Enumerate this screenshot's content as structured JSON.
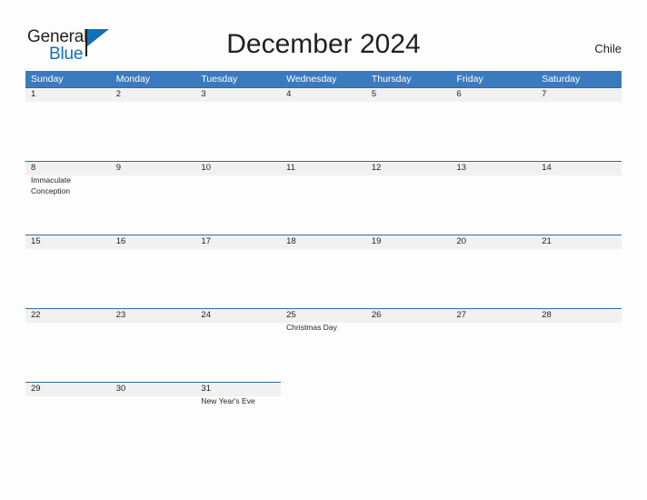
{
  "brand": {
    "name_part1": "General",
    "name_part2": "Blue",
    "flag_icon": "blue-triangle-flag-icon",
    "accent_color": "#1270b8"
  },
  "header": {
    "title": "December 2024",
    "region": "Chile"
  },
  "calendar": {
    "header_bg_color": "#3a7bbf",
    "day_band_color": "#f1f1f1",
    "day_band_border_color": "#2e6da4",
    "weekdays": [
      "Sunday",
      "Monday",
      "Tuesday",
      "Wednesday",
      "Thursday",
      "Friday",
      "Saturday"
    ],
    "weeks": [
      {
        "filled_days": 7,
        "days": [
          {
            "num": "1",
            "events": []
          },
          {
            "num": "2",
            "events": []
          },
          {
            "num": "3",
            "events": []
          },
          {
            "num": "4",
            "events": []
          },
          {
            "num": "5",
            "events": []
          },
          {
            "num": "6",
            "events": []
          },
          {
            "num": "7",
            "events": []
          }
        ]
      },
      {
        "filled_days": 7,
        "days": [
          {
            "num": "8",
            "events": [
              "Immaculate Conception"
            ]
          },
          {
            "num": "9",
            "events": []
          },
          {
            "num": "10",
            "events": []
          },
          {
            "num": "11",
            "events": []
          },
          {
            "num": "12",
            "events": []
          },
          {
            "num": "13",
            "events": []
          },
          {
            "num": "14",
            "events": []
          }
        ]
      },
      {
        "filled_days": 7,
        "days": [
          {
            "num": "15",
            "events": []
          },
          {
            "num": "16",
            "events": []
          },
          {
            "num": "17",
            "events": []
          },
          {
            "num": "18",
            "events": []
          },
          {
            "num": "19",
            "events": []
          },
          {
            "num": "20",
            "events": []
          },
          {
            "num": "21",
            "events": []
          }
        ]
      },
      {
        "filled_days": 7,
        "days": [
          {
            "num": "22",
            "events": []
          },
          {
            "num": "23",
            "events": []
          },
          {
            "num": "24",
            "events": []
          },
          {
            "num": "25",
            "events": [
              "Christmas Day"
            ]
          },
          {
            "num": "26",
            "events": []
          },
          {
            "num": "27",
            "events": []
          },
          {
            "num": "28",
            "events": []
          }
        ]
      },
      {
        "filled_days": 3,
        "days": [
          {
            "num": "29",
            "events": []
          },
          {
            "num": "30",
            "events": []
          },
          {
            "num": "31",
            "events": [
              "New Year's Eve"
            ]
          },
          {
            "num": "",
            "events": []
          },
          {
            "num": "",
            "events": []
          },
          {
            "num": "",
            "events": []
          },
          {
            "num": "",
            "events": []
          }
        ]
      }
    ]
  }
}
